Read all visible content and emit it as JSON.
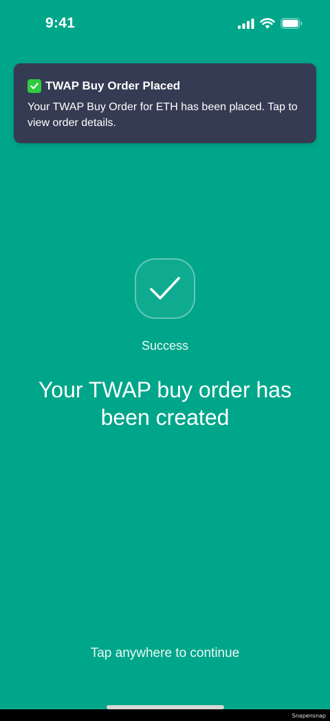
{
  "status_bar": {
    "time": "9:41",
    "icons": [
      "cellular-signal-icon",
      "wifi-icon",
      "battery-icon"
    ]
  },
  "notification": {
    "icon": "check-mark-icon",
    "title": "TWAP Buy Order Placed",
    "body": "Your TWAP Buy Order for ETH has been placed. Tap to view order details."
  },
  "main": {
    "badge_icon": "check-icon",
    "status_label": "Success",
    "headline": "Your TWAP buy order has been created",
    "continue_hint": "Tap anywhere to continue"
  },
  "footer": {
    "watermark": "Snapensnap"
  },
  "colors": {
    "background": "#00a68a",
    "notification_bg": "#343b52",
    "check_green": "#2ecc40"
  }
}
